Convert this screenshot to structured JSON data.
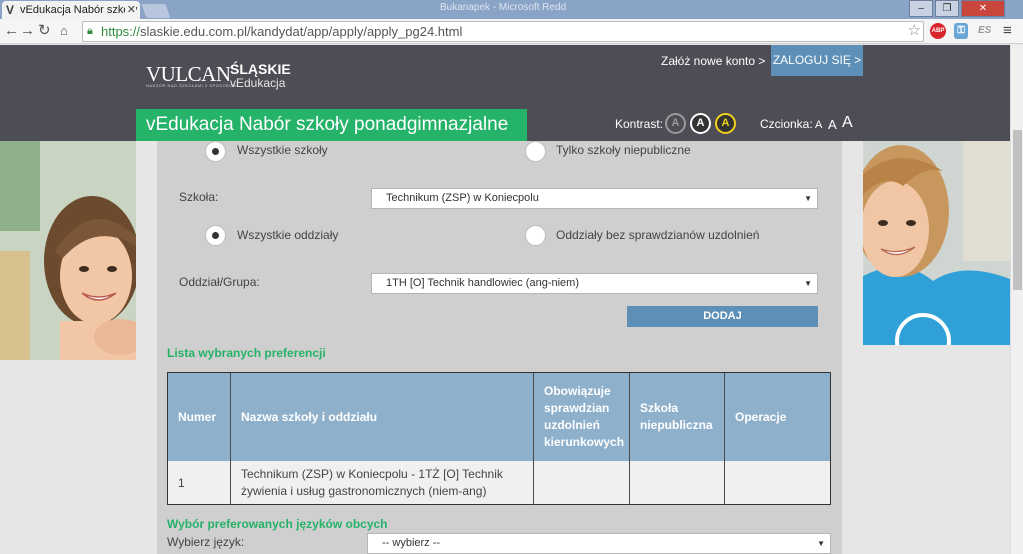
{
  "browser": {
    "tab_title": "vEdukacja Nabór szkoły p",
    "tab_favicon": "V",
    "url_scheme": "https://",
    "url_rest": "slaskie.edu.com.pl/kandydat/app/apply/apply_pg24.html",
    "window_title": "Bukanapek - Microsoft Redd"
  },
  "header": {
    "logo_vulcan": "VULCAN",
    "logo_sub": "NADZÓR NAD SZKOŁAMI Z SPOSOBÓW",
    "logo_slaskie": "ŚLĄSKIE",
    "logo_vedukacja": "vEdukacja",
    "new_account": "Załóż nowe konto >",
    "login": "ZALOGUJ SIĘ >",
    "site_title": "vEdukacja Nabór szkoły ponadgimnazjalne",
    "contrast_label": "Kontrast:",
    "contrast_options": [
      "A",
      "A",
      "A"
    ],
    "font_label": "Czcionka:",
    "font_sizes": [
      "A",
      "A",
      "A"
    ]
  },
  "filters": {
    "school_type": {
      "options": [
        "Wszystkie szkoły",
        "Tylko szkoły niepubliczne"
      ],
      "selected": 0
    },
    "school_label": "Szkoła:",
    "school_value": "Technikum (ZSP) w Koniecpolu",
    "class_type": {
      "options": [
        "Wszystkie oddziały",
        "Oddziały bez sprawdzianów uzdolnień"
      ],
      "selected": 0
    },
    "class_label": "Oddział/Grupa:",
    "class_value": "1TH [O] Technik handlowiec (ang-niem)",
    "add_button": "DODAJ"
  },
  "preferences": {
    "section_title": "Lista wybranych preferencji",
    "columns": [
      "Numer",
      "Nazwa szkoły i oddziału",
      "Obowiązuje sprawdzian uzdolnień kierunkowych",
      "Szkoła niepubliczna",
      "Operacje"
    ],
    "rows": [
      {
        "num": "1",
        "name": "Technikum (ZSP) w Koniecpolu - 1TŻ [O] Technik żywienia i usług gastronomicznych (niem-ang)",
        "test": "",
        "private": "",
        "ops": ""
      }
    ]
  },
  "languages": {
    "section_title": "Wybór preferowanych języków obcych",
    "select_label": "Wybierz język:",
    "select_value": "-- wybierz --"
  },
  "colors": {
    "accent_green": "#25b269",
    "header_bg": "#4d4d56",
    "button_blue": "#5d8fb7",
    "table_header": "#8eb0cb"
  }
}
